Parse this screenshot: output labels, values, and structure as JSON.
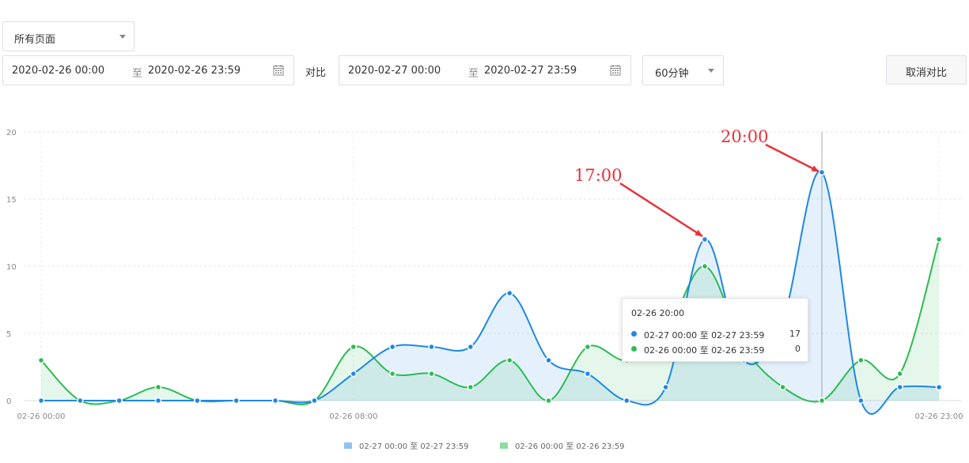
{
  "controls": {
    "page_select": "所有页面",
    "range1_start": "2020-02-26 00:00",
    "range1_sep": "至",
    "range1_end": "2020-02-26 23:59",
    "compare_label": "对比",
    "range2_start": "2020-02-27 00:00",
    "range2_sep": "至",
    "range2_end": "2020-02-27 23:59",
    "interval": "60分钟",
    "cancel_compare": "取消对比"
  },
  "chart_data": {
    "type": "area",
    "x": [
      "00:00",
      "01:00",
      "02:00",
      "03:00",
      "04:00",
      "05:00",
      "06:00",
      "07:00",
      "08:00",
      "09:00",
      "10:00",
      "11:00",
      "12:00",
      "13:00",
      "14:00",
      "15:00",
      "16:00",
      "17:00",
      "18:00",
      "19:00",
      "20:00",
      "21:00",
      "22:00",
      "23:00"
    ],
    "x_tick_labels": [
      "02-26 00:00",
      "02-26 08:00",
      "02-26 23:00"
    ],
    "y_tick_labels": [
      "0",
      "5",
      "10",
      "15",
      "20"
    ],
    "ylim": [
      0,
      20
    ],
    "grid": true,
    "legend_position": "bottom",
    "series": [
      {
        "name": "02-27 00:00 至 02-27 23:59",
        "color": "#1e88e5",
        "values": [
          0,
          0,
          0,
          0,
          0,
          0,
          0,
          0,
          2,
          4,
          4,
          4,
          8,
          3,
          2,
          0,
          1,
          12,
          3,
          6,
          17,
          0,
          1,
          1
        ]
      },
      {
        "name": "02-26 00:00 至 02-26 23:59",
        "color": "#2dbb55",
        "values": [
          3,
          0,
          0,
          1,
          0,
          0,
          0,
          0,
          4,
          2,
          2,
          1,
          3,
          0,
          4,
          3,
          5,
          10,
          4,
          1,
          0,
          3,
          2,
          12
        ]
      }
    ],
    "annotations": [
      "17:00",
      "20:00"
    ],
    "tooltip": {
      "title": "02-26 20:00",
      "rows": [
        {
          "label": "02-27 00:00 至 02-27 23:59",
          "value": "17",
          "color": "#1e88e5"
        },
        {
          "label": "02-26 00:00 至 02-26 23:59",
          "value": "0",
          "color": "#2dbb55"
        }
      ]
    }
  }
}
